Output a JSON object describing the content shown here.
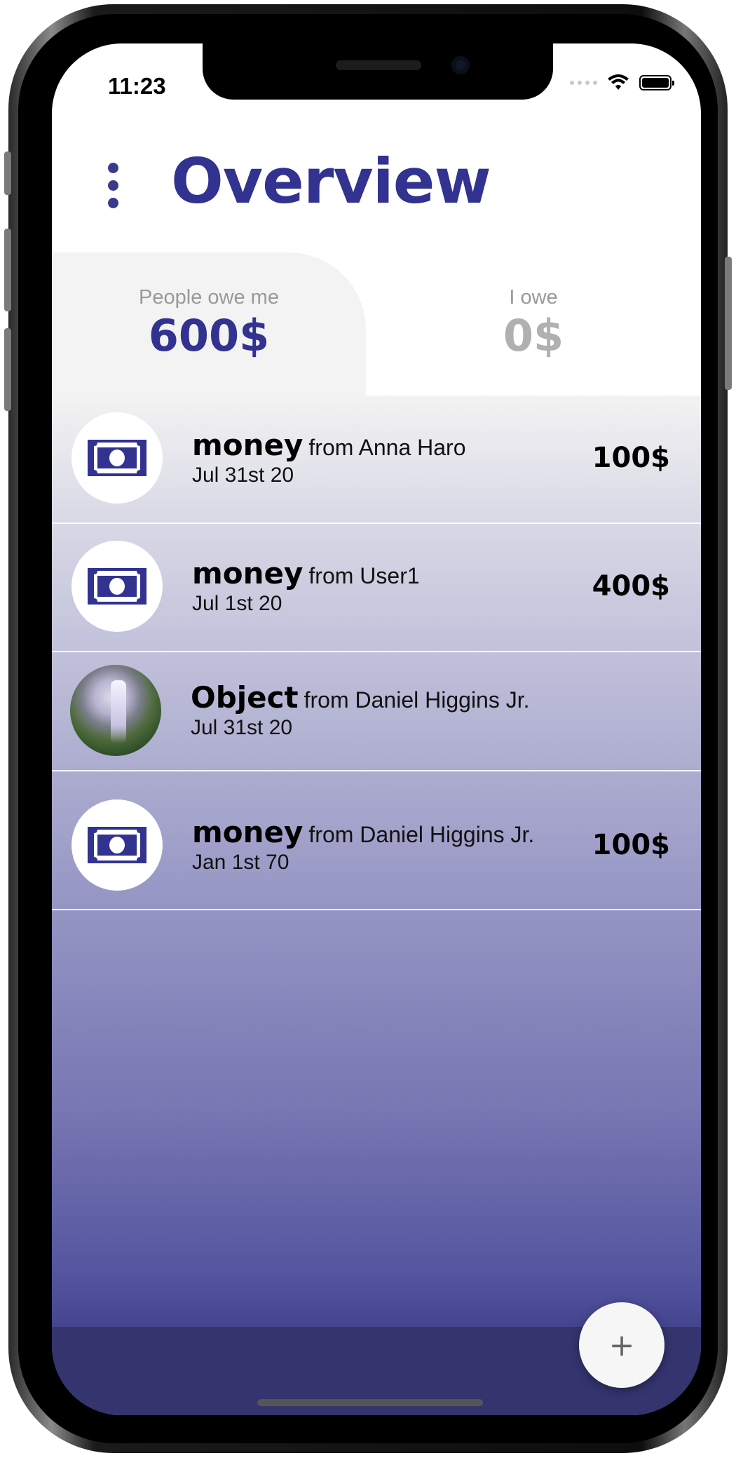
{
  "status_bar": {
    "time": "11:23"
  },
  "header": {
    "title": "Overview"
  },
  "tabs": [
    {
      "label": "People owe me",
      "value": "600$",
      "active": true,
      "color": "#323290"
    },
    {
      "label": "I owe",
      "value": "0$",
      "active": false,
      "color": "#b0b0b0"
    }
  ],
  "transactions": [
    {
      "type": "money",
      "from": "from Anna Haro",
      "date": "Jul 31st 20",
      "amount": "100$",
      "icon": "money-bill-icon"
    },
    {
      "type": "money",
      "from": "from User1",
      "date": "Jul 1st 20",
      "amount": "400$",
      "icon": "money-bill-icon"
    },
    {
      "type": "Object",
      "from": "from Daniel Higgins Jr.",
      "date": "Jul 31st 20",
      "amount": "",
      "icon": "waterfall-photo"
    },
    {
      "type": "money",
      "from": "from Daniel Higgins Jr.",
      "date": "Jan 1st 70",
      "amount": "100$",
      "icon": "money-bill-icon"
    }
  ],
  "fab": {
    "label": "+"
  },
  "colors": {
    "accent": "#323290",
    "bottom_bar": "#34346f"
  }
}
